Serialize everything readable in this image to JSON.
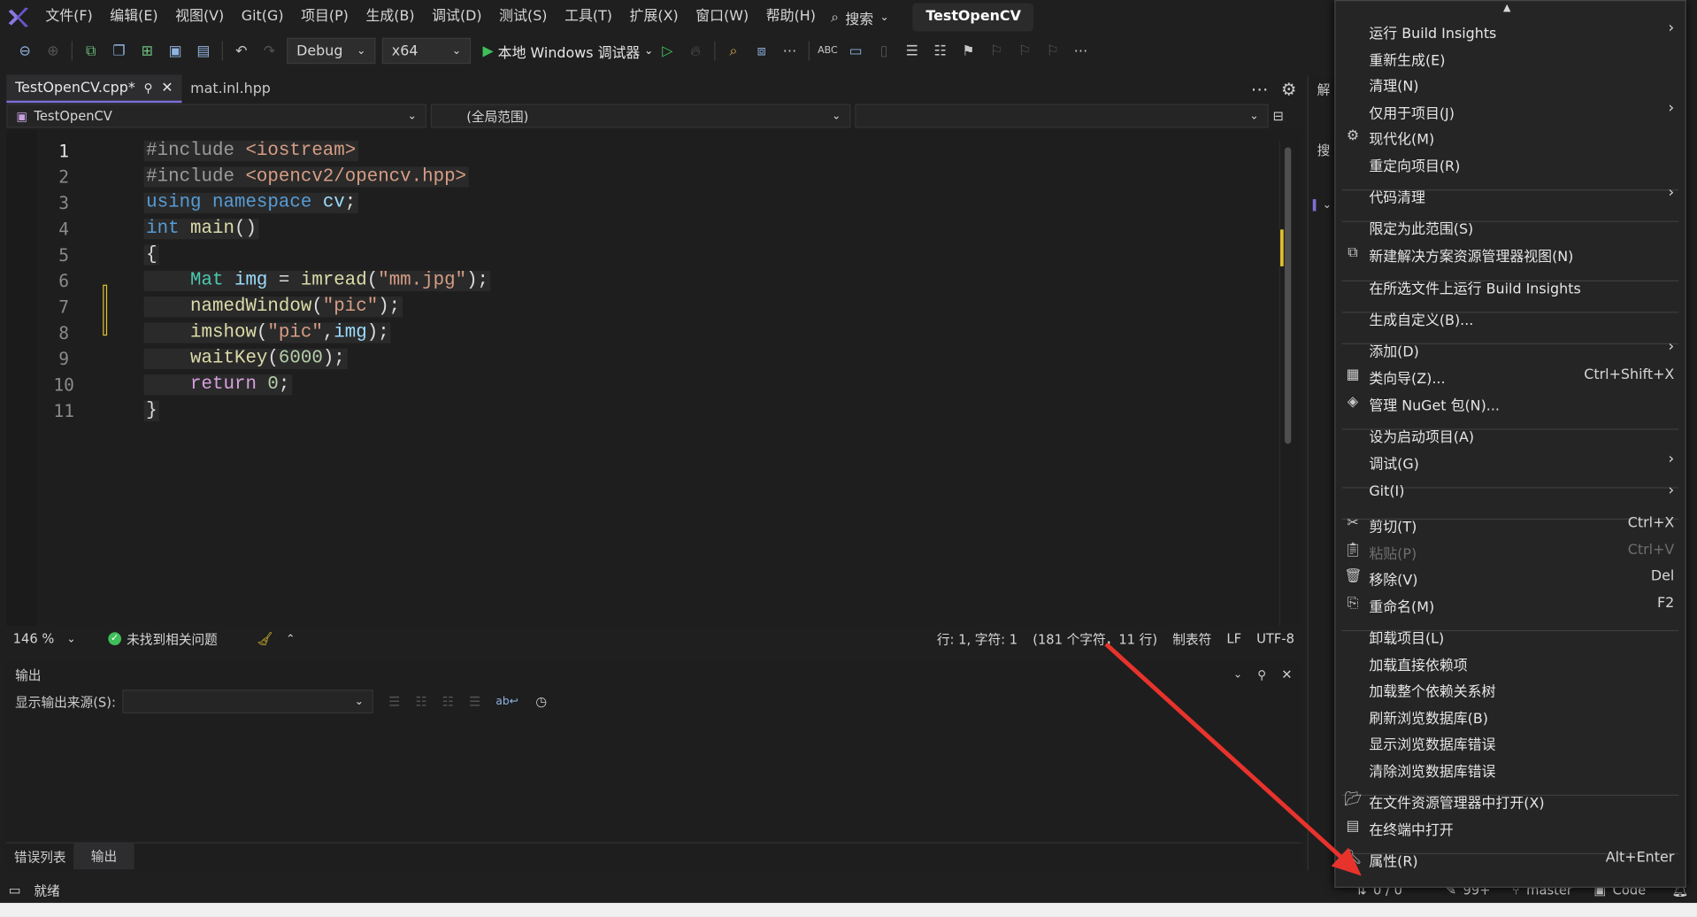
{
  "menubar": {
    "items": [
      "文件(F)",
      "编辑(E)",
      "视图(V)",
      "Git(G)",
      "项目(P)",
      "生成(B)",
      "调试(D)",
      "测试(S)",
      "工具(T)",
      "扩展(X)",
      "窗口(W)",
      "帮助(H)"
    ],
    "search_label": "搜索",
    "solution_title": "TestOpenCV"
  },
  "toolbar": {
    "config": "Debug",
    "platform": "x64",
    "run_label": "本地 Windows 调试器"
  },
  "tabs": [
    {
      "label": "TestOpenCV.cpp*",
      "active": true
    },
    {
      "label": "mat.inl.hpp",
      "active": false
    }
  ],
  "navbar": {
    "project": "TestOpenCV",
    "scope": "(全局范围)",
    "member": ""
  },
  "editor": {
    "line_numbers": [
      "1",
      "2",
      "3",
      "4",
      "5",
      "6",
      "7",
      "8",
      "9",
      "10",
      "11"
    ],
    "lines": [
      "#include <iostream>",
      "#include <opencv2/opencv.hpp>",
      "using namespace cv;",
      "int main()",
      "{",
      "    Mat img = imread(\"mm.jpg\");",
      "    namedWindow(\"pic\");",
      "    imshow(\"pic\",img);",
      "    waitKey(6000);",
      "    return 0;",
      "}"
    ]
  },
  "editor_status": {
    "zoom": "146 %",
    "issues": "未找到相关问题",
    "position": "行: 1, 字符: 1",
    "counts": "(181 个字符，11 行)",
    "indent": "制表符",
    "eol": "LF",
    "encoding": "UTF-8"
  },
  "output_panel": {
    "title": "输出",
    "source_label": "显示输出来源(S):",
    "source_value": "",
    "bottom_tabs": [
      "错误列表",
      "输出"
    ]
  },
  "statusbar": {
    "ready": "就绪",
    "sync": "0 / 0",
    "pending": "99+",
    "branch": "master",
    "repo": "Code"
  },
  "solution_explorer": {
    "title_partial": "解",
    "search_partial": "搜"
  },
  "context_menu": {
    "items": [
      {
        "label": "运行 Build Insights",
        "arrow": "›",
        "icon": ""
      },
      {
        "label": "重新生成(E)",
        "icon": ""
      },
      {
        "label": "清理(N)",
        "icon": ""
      },
      {
        "label": "仅用于项目(J)",
        "arrow": "›",
        "icon": ""
      },
      {
        "label": "现代化(M)",
        "icon": "modernize-icon"
      },
      {
        "label": "重定向项目(R)",
        "icon": ""
      },
      {
        "label": "代码清理",
        "arrow": "›",
        "icon": ""
      },
      {
        "label": "限定为此范围(S)",
        "icon": ""
      },
      {
        "label": "新建解决方案资源管理器视图(N)",
        "icon": "new-view-icon"
      },
      {
        "label": "在所选文件上运行 Build Insights",
        "icon": ""
      },
      {
        "label": "生成自定义(B)...",
        "icon": ""
      },
      {
        "label": "添加(D)",
        "arrow": "›",
        "icon": ""
      },
      {
        "label": "类向导(Z)...",
        "shortcut": "Ctrl+Shift+X",
        "icon": "class-wizard-icon"
      },
      {
        "label": "管理 NuGet 包(N)...",
        "icon": "nuget-icon"
      },
      {
        "label": "设为启动项目(A)",
        "icon": ""
      },
      {
        "label": "调试(G)",
        "arrow": "›",
        "icon": ""
      },
      {
        "label": "Git(I)",
        "arrow": "›",
        "icon": ""
      },
      {
        "label": "剪切(T)",
        "shortcut": "Ctrl+X",
        "icon": "scissors-icon"
      },
      {
        "label": "粘贴(P)",
        "shortcut": "Ctrl+V",
        "icon": "paste-icon",
        "disabled": true
      },
      {
        "label": "移除(V)",
        "shortcut": "Del",
        "icon": "trash-icon"
      },
      {
        "label": "重命名(M)",
        "shortcut": "F2",
        "icon": "rename-icon"
      },
      {
        "label": "卸载项目(L)",
        "icon": ""
      },
      {
        "label": "加载直接依赖项",
        "icon": ""
      },
      {
        "label": "加载整个依赖关系树",
        "icon": ""
      },
      {
        "label": "刷新浏览数据库(B)",
        "icon": ""
      },
      {
        "label": "显示浏览数据库错误",
        "icon": ""
      },
      {
        "label": "清除浏览数据库错误",
        "icon": ""
      },
      {
        "label": "在文件资源管理器中打开(X)",
        "icon": "folder-open-icon"
      },
      {
        "label": "在终端中打开",
        "icon": "terminal-icon"
      },
      {
        "label": "属性(R)",
        "shortcut": "Alt+Enter",
        "icon": "wrench-icon"
      }
    ]
  },
  "colors": {
    "accent": "#7b6fd6",
    "annotation_arrow": "#e8332c",
    "run_green": "#3fbf5a"
  }
}
